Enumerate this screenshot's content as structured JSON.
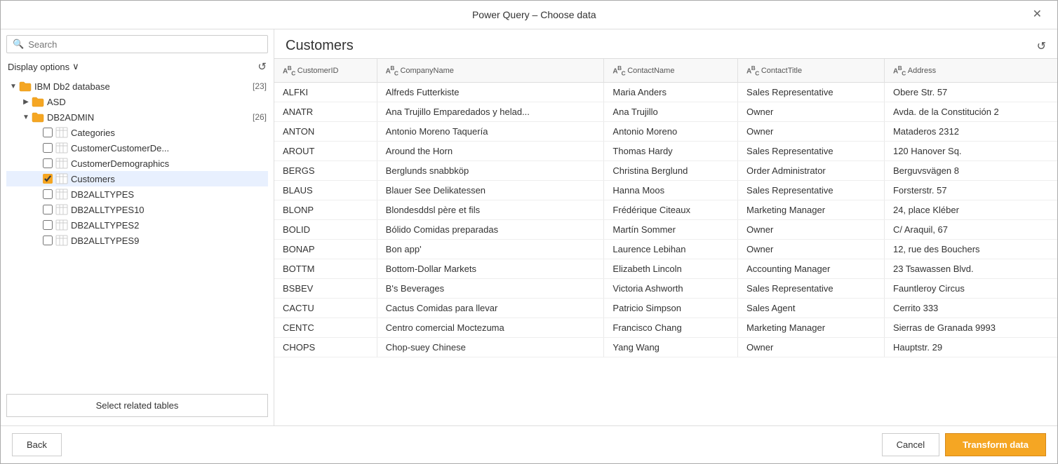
{
  "dialog": {
    "title": "Power Query – Choose data",
    "close_label": "✕"
  },
  "left_panel": {
    "search_placeholder": "Search",
    "display_options_label": "Display options",
    "chevron_down": "∨",
    "refresh_icon": "↺",
    "tree": [
      {
        "type": "folder",
        "label": "IBM Db2 database",
        "count": "[23]",
        "expanded": true,
        "level": 0,
        "chevron": "▼",
        "children": [
          {
            "type": "folder",
            "label": "ASD",
            "count": "",
            "expanded": false,
            "level": 1,
            "chevron": "▶",
            "children": []
          },
          {
            "type": "folder",
            "label": "DB2ADMIN",
            "count": "[26]",
            "expanded": true,
            "level": 1,
            "chevron": "▼",
            "children": [
              {
                "type": "table",
                "label": "Categories",
                "checked": false,
                "selected": false,
                "level": 2
              },
              {
                "type": "table",
                "label": "CustomerCustomerDe...",
                "checked": false,
                "selected": false,
                "level": 2
              },
              {
                "type": "table",
                "label": "CustomerDemographics",
                "checked": false,
                "selected": false,
                "level": 2
              },
              {
                "type": "table",
                "label": "Customers",
                "checked": true,
                "selected": true,
                "level": 2
              },
              {
                "type": "table",
                "label": "DB2ALLTYPES",
                "checked": false,
                "selected": false,
                "level": 2
              },
              {
                "type": "table",
                "label": "DB2ALLTYPES10",
                "checked": false,
                "selected": false,
                "level": 2
              },
              {
                "type": "table",
                "label": "DB2ALLTYPES2",
                "checked": false,
                "selected": false,
                "level": 2
              },
              {
                "type": "table",
                "label": "DB2ALLTYPES9",
                "checked": false,
                "selected": false,
                "level": 2
              }
            ]
          }
        ]
      }
    ],
    "select_related_tables_label": "Select related tables"
  },
  "right_panel": {
    "title": "Customers",
    "refresh_icon": "↺",
    "columns": [
      {
        "name": "CustomerID",
        "type": "ABC"
      },
      {
        "name": "CompanyName",
        "type": "ABC"
      },
      {
        "name": "ContactName",
        "type": "ABC"
      },
      {
        "name": "ContactTitle",
        "type": "ABC"
      },
      {
        "name": "Address",
        "type": "ABC"
      }
    ],
    "rows": [
      [
        "ALFKI",
        "Alfreds Futterkiste",
        "Maria Anders",
        "Sales Representative",
        "Obere Str. 57"
      ],
      [
        "ANATR",
        "Ana Trujillo Emparedados y helad...",
        "Ana Trujillo",
        "Owner",
        "Avda. de la Constitución 2"
      ],
      [
        "ANTON",
        "Antonio Moreno Taquería",
        "Antonio Moreno",
        "Owner",
        "Mataderos 2312"
      ],
      [
        "AROUT",
        "Around the Horn",
        "Thomas Hardy",
        "Sales Representative",
        "120 Hanover Sq."
      ],
      [
        "BERGS",
        "Berglunds snabbköp",
        "Christina Berglund",
        "Order Administrator",
        "Berguvsvägen 8"
      ],
      [
        "BLAUS",
        "Blauer See Delikatessen",
        "Hanna Moos",
        "Sales Representative",
        "Forsterstr. 57"
      ],
      [
        "BLONP",
        "Blondesddsl père et fils",
        "Frédérique Citeaux",
        "Marketing Manager",
        "24, place Kléber"
      ],
      [
        "BOLID",
        "Bólido Comidas preparadas",
        "Martín Sommer",
        "Owner",
        "C/ Araquil, 67"
      ],
      [
        "BONAP",
        "Bon app'",
        "Laurence Lebihan",
        "Owner",
        "12, rue des Bouchers"
      ],
      [
        "BOTTM",
        "Bottom-Dollar Markets",
        "Elizabeth Lincoln",
        "Accounting Manager",
        "23 Tsawassen Blvd."
      ],
      [
        "BSBEV",
        "B's Beverages",
        "Victoria Ashworth",
        "Sales Representative",
        "Fauntleroy Circus"
      ],
      [
        "CACTU",
        "Cactus Comidas para llevar",
        "Patricio Simpson",
        "Sales Agent",
        "Cerrito 333"
      ],
      [
        "CENTC",
        "Centro comercial Moctezuma",
        "Francisco Chang",
        "Marketing Manager",
        "Sierras de Granada 9993"
      ],
      [
        "CHOPS",
        "Chop-suey Chinese",
        "Yang Wang",
        "Owner",
        "Hauptstr. 29"
      ]
    ]
  },
  "footer": {
    "back_label": "Back",
    "cancel_label": "Cancel",
    "transform_label": "Transform data"
  }
}
